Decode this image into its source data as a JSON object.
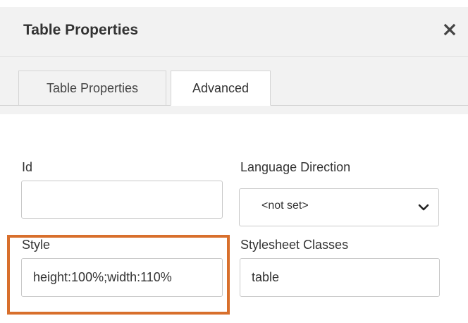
{
  "dialog": {
    "title": "Table Properties"
  },
  "tabs": [
    {
      "label": "Table Properties",
      "active": false
    },
    {
      "label": "Advanced",
      "active": true
    }
  ],
  "fields": {
    "id": {
      "label": "Id",
      "value": ""
    },
    "language_direction": {
      "label": "Language Direction",
      "selected": "<not set>"
    },
    "style": {
      "label": "Style",
      "value": "height:100%;width:110%"
    },
    "stylesheet_classes": {
      "label": "Stylesheet Classes",
      "value": "table"
    }
  },
  "colors": {
    "highlight": "#d86f2c",
    "titlebar_bg": "#f2f2f2"
  },
  "icons": {
    "close": "close-icon",
    "dropdown": "chevron-down-icon"
  }
}
